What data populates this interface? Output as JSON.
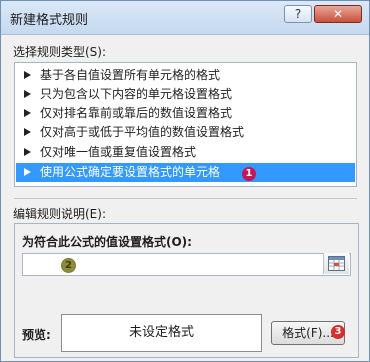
{
  "window": {
    "title": "新建格式规则",
    "help_label": "?",
    "close_label": "✕"
  },
  "select_rule_type_label": "选择规则类型(S):",
  "rule_types": [
    {
      "label": "基于各自值设置所有单元格的格式"
    },
    {
      "label": "只为包含以下内容的单元格设置格式"
    },
    {
      "label": "仅对排名靠前或靠后的数值设置格式"
    },
    {
      "label": "仅对高于或低于平均值的数值设置格式"
    },
    {
      "label": "仅对唯一值或重复值设置格式"
    },
    {
      "label": "使用公式确定要设置格式的单元格"
    }
  ],
  "selected_rule_index": 5,
  "edit_rule_label": "编辑规则说明(E):",
  "formula_label": "为符合此公式的值设置格式(O):",
  "formula_value": "",
  "preview_label": "预览:",
  "preview_text": "未设定格式",
  "format_button_label": "格式(F)...",
  "annotations": {
    "one": "1",
    "two": "2",
    "three": "3"
  },
  "colors": {
    "selection": "#3399ff",
    "title_bar": "#c5d9f0"
  }
}
